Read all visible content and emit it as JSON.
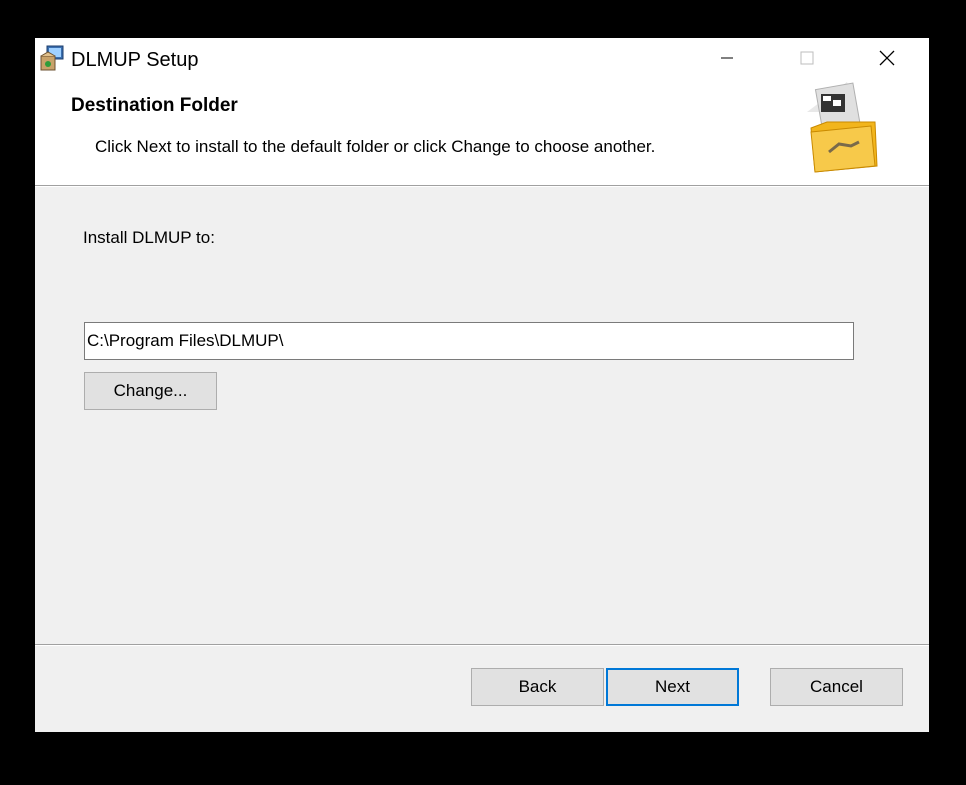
{
  "window": {
    "title": "DLMUP Setup",
    "icons": {
      "app": "setup-package-icon",
      "minimize": "minimize-icon",
      "maximize": "maximize-icon",
      "close": "close-icon"
    }
  },
  "banner": {
    "title": "Destination Folder",
    "subtitle": "Click Next to install to the default folder or click Change to choose another.",
    "image": "folder-with-installer-icon"
  },
  "main": {
    "install_label": "Install DLMUP to:",
    "path_value": "C:\\Program Files\\DLMUP\\",
    "change_label": "Change..."
  },
  "buttons": {
    "back": "Back",
    "next": "Next",
    "cancel": "Cancel"
  },
  "colors": {
    "focus_border": "#0078d7",
    "window_bg": "#f0f0f0",
    "banner_bg": "#ffffff"
  }
}
